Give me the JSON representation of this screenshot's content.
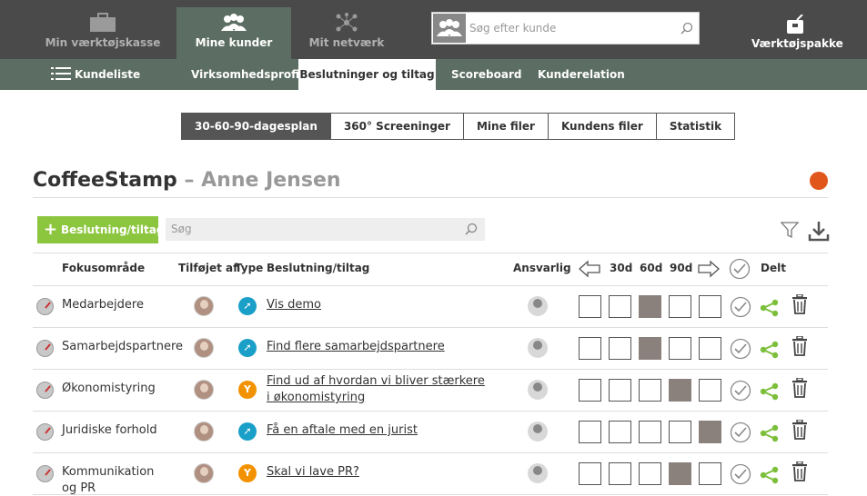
{
  "topnav": {
    "toolbox": "Min værktøjskasse",
    "customers": "Mine kunder",
    "network": "Mit netværk",
    "search_placeholder": "Søg efter kunde",
    "toolkit": "Værktøjspakke"
  },
  "subnav": {
    "list": "Kundeliste",
    "tabs": [
      "Virksomhedsprofil",
      "Beslutninger og tiltag",
      "Scoreboard",
      "Kunderelation"
    ]
  },
  "segments": [
    "30-60-90-dagesplan",
    "360° Screeninger",
    "Mine filer",
    "Kundens filer",
    "Statistik"
  ],
  "title": {
    "company": "CoffeeStamp",
    "person": "– Anne Jensen"
  },
  "actions": {
    "add": "Beslutning/tiltag",
    "search_placeholder": "Søg"
  },
  "table": {
    "headers": {
      "focus": "Fokusområde",
      "added_by": "Tilføjet af",
      "type": "Type",
      "decision": "Beslutning/tiltag",
      "responsible": "Ansvarlig",
      "d30": "30d",
      "d60": "60d",
      "d90": "90d",
      "shared": "Delt"
    },
    "rows": [
      {
        "focus": "Medarbejdere",
        "type": "walk",
        "decision": "Vis demo",
        "filled": 2
      },
      {
        "focus": "Samarbejdspartnere",
        "type": "walk",
        "decision": "Find flere samarbejdspartnere",
        "filled": 2
      },
      {
        "focus": "Økonomistyring",
        "type": "split",
        "decision": "Find ud af hvordan vi bliver stærkere i økonomistyring",
        "filled": 3
      },
      {
        "focus": "Juridiske forhold",
        "type": "walk",
        "decision": "Få en aftale med en jurist",
        "filled": 4
      },
      {
        "focus": "Kommunikation og PR",
        "type": "split",
        "decision": "Skal vi lave PR?",
        "filled": 3
      }
    ]
  },
  "colors": {
    "accent": "#8cc63f",
    "subnav": "#5c6e63",
    "topbar": "#4a4a4a",
    "filled_box": "#8a817c"
  }
}
